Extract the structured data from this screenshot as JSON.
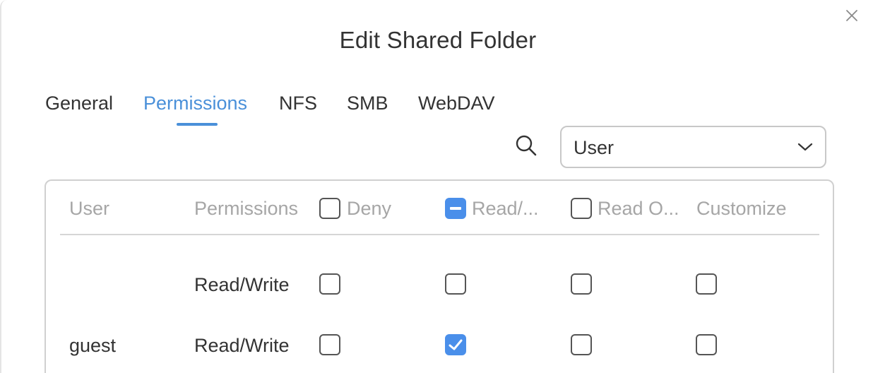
{
  "dialog": {
    "title": "Edit Shared Folder"
  },
  "tabs": [
    {
      "label": "General",
      "active": false
    },
    {
      "label": "Permissions",
      "active": true
    },
    {
      "label": "NFS",
      "active": false
    },
    {
      "label": "SMB",
      "active": false
    },
    {
      "label": "WebDAV",
      "active": false
    }
  ],
  "filter": {
    "search_icon": "search-icon",
    "selected": "User"
  },
  "table": {
    "headers": {
      "user": "User",
      "permissions": "Permissions",
      "deny": "Deny",
      "read_write": "Read/...",
      "read_only": "Read O...",
      "customize": "Customize"
    },
    "header_checkboxes": {
      "deny": "unchecked",
      "read_write": "indeterminate",
      "read_only": "unchecked"
    },
    "rows": [
      {
        "user": "",
        "permissions": "Read/Write",
        "deny": false,
        "read_write": false,
        "read_only": false,
        "customize": false
      },
      {
        "user": "guest",
        "permissions": "Read/Write",
        "deny": false,
        "read_write": true,
        "read_only": false,
        "customize": false
      }
    ]
  },
  "colors": {
    "accent": "#4a90d9",
    "checkbox_fill": "#4a8fea",
    "header_text": "#a6a6a6"
  }
}
